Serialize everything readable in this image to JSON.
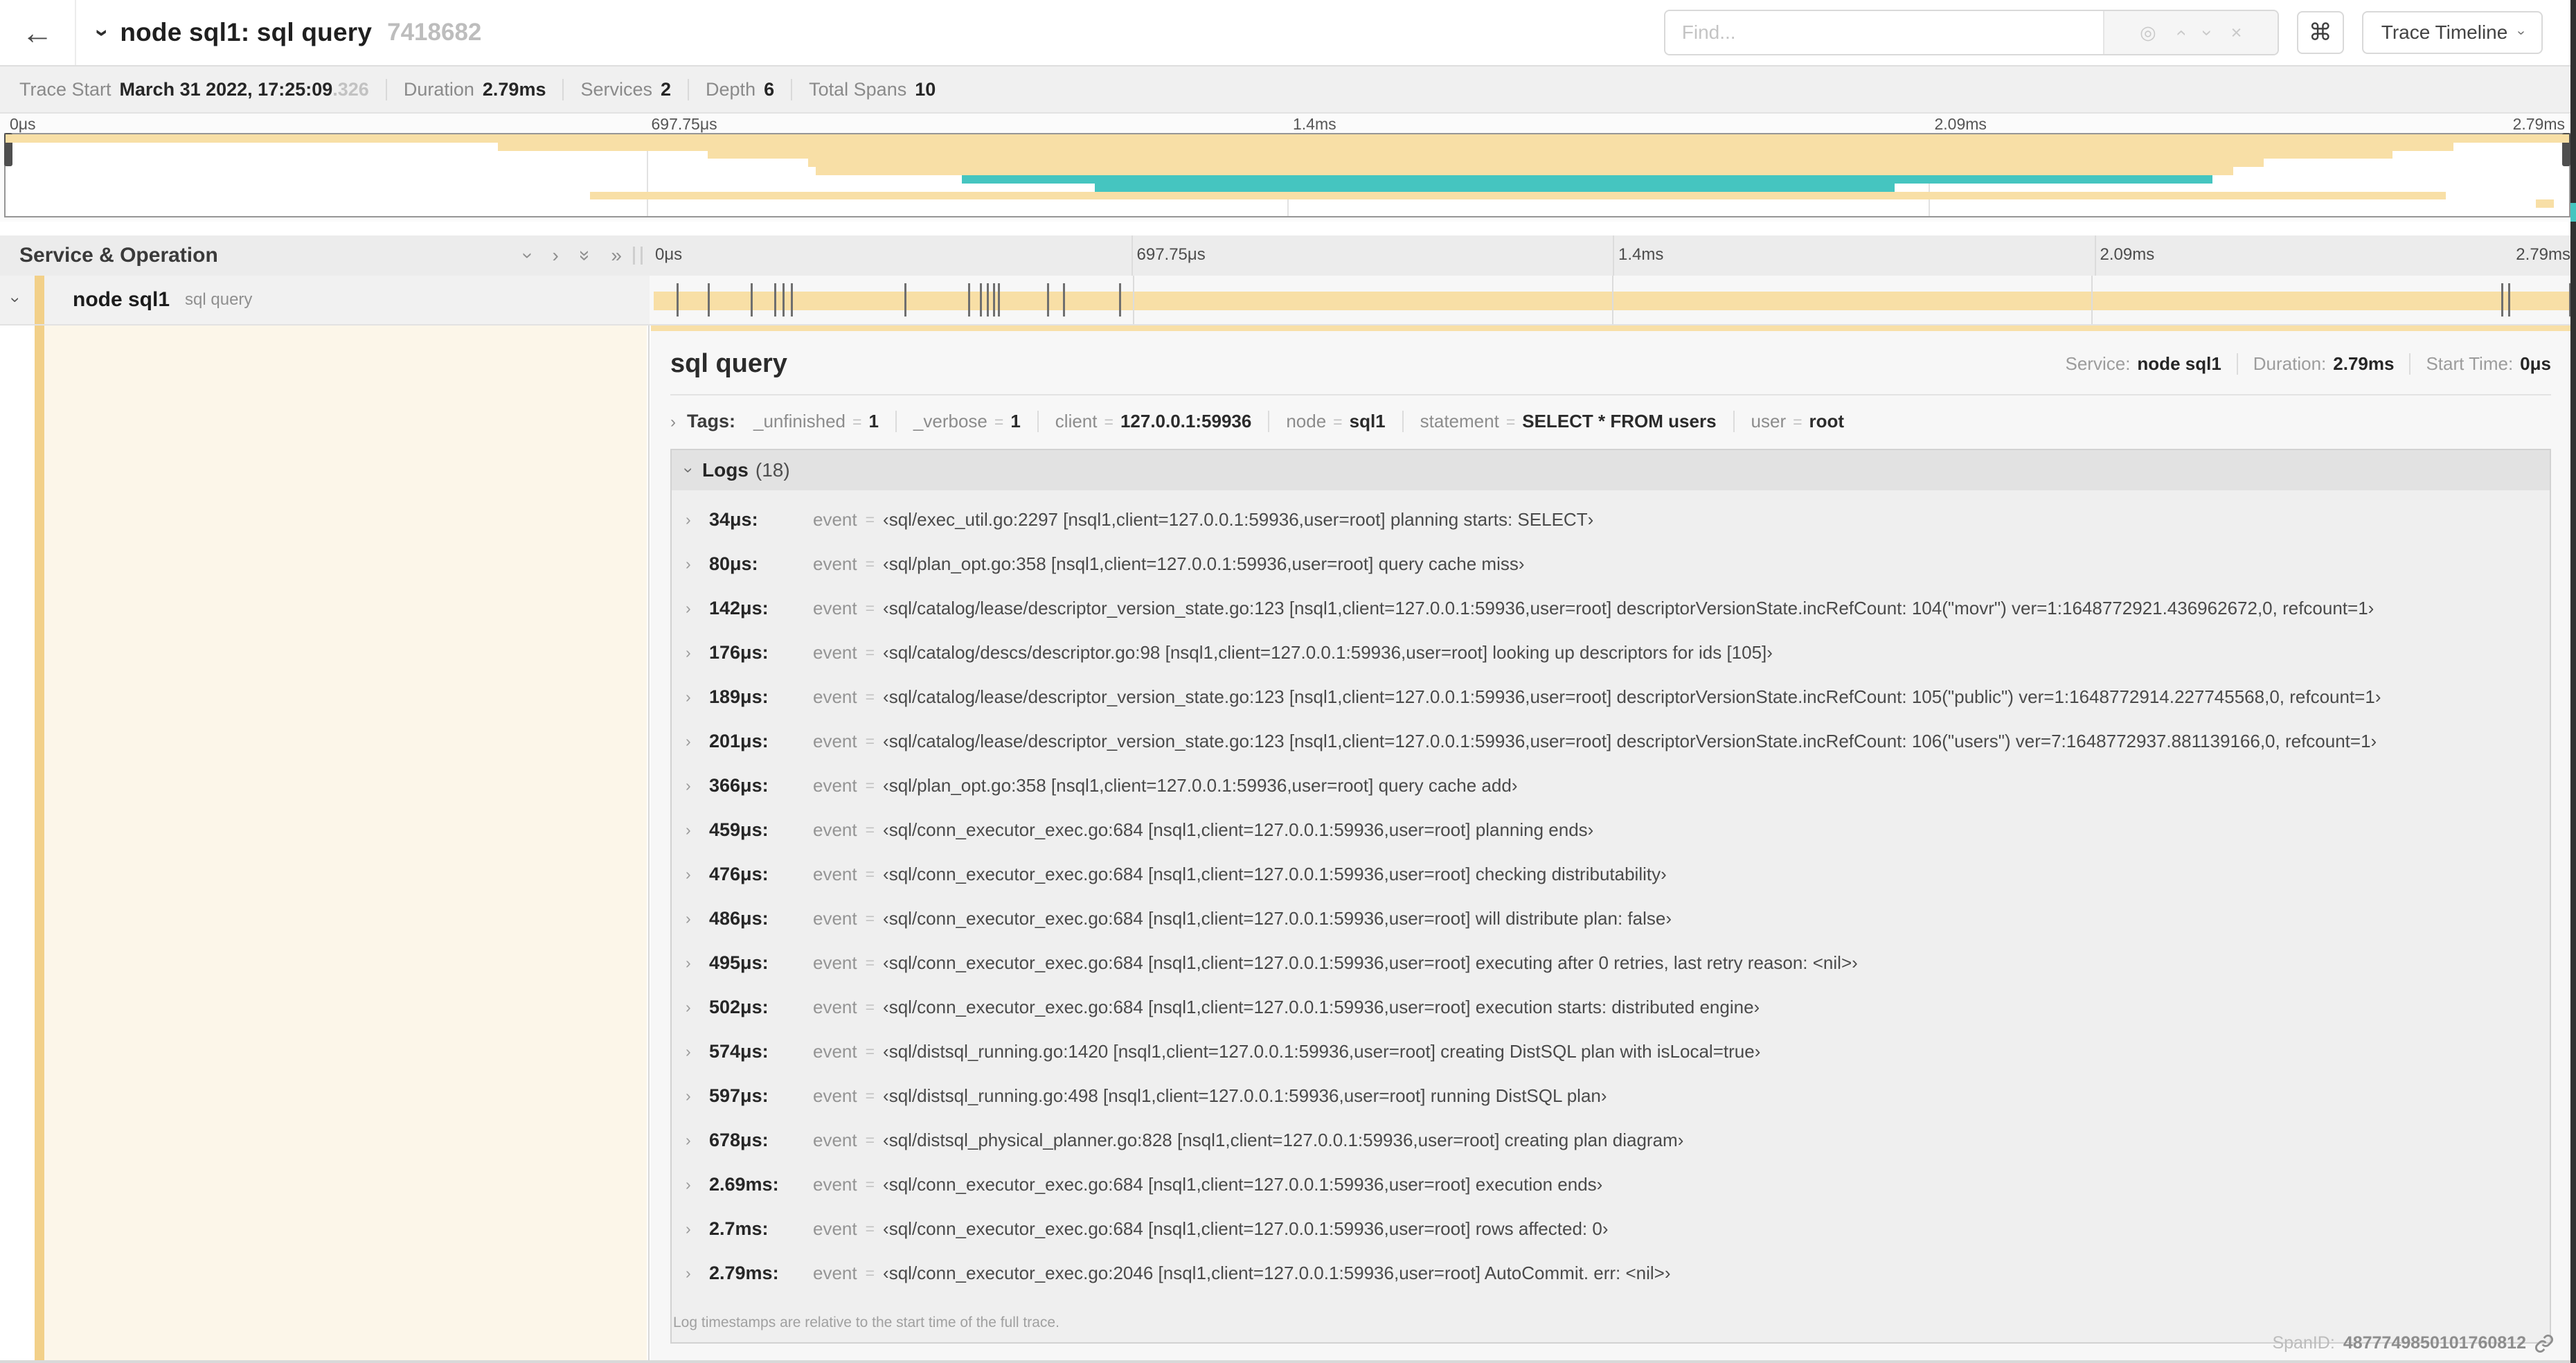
{
  "colors": {
    "bar_orange": "#f8dfa6",
    "accent_orange": "#f2d089",
    "teal": "#45c5c0",
    "cream": "#fcf6e9"
  },
  "topbar": {
    "back_icon": "←",
    "collapse_chevron_icon": "›",
    "title": "node sql1: sql query",
    "trace_id": "7418682",
    "find": {
      "placeholder": "Find...",
      "locate_icon": "◎",
      "prev_icon": "›",
      "next_icon": "›",
      "clear_icon": "×"
    },
    "shortcuts_icon": "⌘",
    "view_menu": {
      "label": "Trace Timeline",
      "chevron_icon": "›"
    }
  },
  "trace_stats": [
    {
      "label": "Trace Start",
      "value": "March 31 2022, 17:25:09",
      "suffix": ".326"
    },
    {
      "label": "Duration",
      "value": "2.79ms",
      "suffix": ""
    },
    {
      "label": "Services",
      "value": "2",
      "suffix": ""
    },
    {
      "label": "Depth",
      "value": "6",
      "suffix": ""
    },
    {
      "label": "Total Spans",
      "value": "10",
      "suffix": ""
    }
  ],
  "minimap": {
    "axis_labels": [
      {
        "text": "0μs",
        "pct": 0
      },
      {
        "text": "697.75μs",
        "pct": 25
      },
      {
        "text": "1.4ms",
        "pct": 50
      },
      {
        "text": "2.09ms",
        "pct": 75
      },
      {
        "text": "2.79ms",
        "pct": 100
      }
    ],
    "gridline_pcts": [
      25,
      50,
      75
    ],
    "spans": [
      {
        "row": 0,
        "start_pct": 0,
        "end_pct": 100,
        "color": "orange"
      },
      {
        "row": 1,
        "start_pct": 19.2,
        "end_pct": 95.5,
        "color": "orange"
      },
      {
        "row": 2,
        "start_pct": 27.4,
        "end_pct": 93.1,
        "color": "orange"
      },
      {
        "row": 3,
        "start_pct": 31.3,
        "end_pct": 88.1,
        "color": "orange"
      },
      {
        "row": 4,
        "start_pct": 31.6,
        "end_pct": 86.9,
        "color": "orange"
      },
      {
        "row": 5,
        "start_pct": 37.3,
        "end_pct": 86.1,
        "color": "teal"
      },
      {
        "row": 6,
        "start_pct": 42.5,
        "end_pct": 73.7,
        "color": "teal"
      },
      {
        "row": 7,
        "start_pct": 22.8,
        "end_pct": 95.2,
        "color": "orange"
      },
      {
        "row": 8,
        "start_pct": 98.7,
        "end_pct": 99.4,
        "color": "orange"
      }
    ]
  },
  "timeline": {
    "column_header": "Service & Operation",
    "toolbar": {
      "collapse_one_icon": "›",
      "expand_one_icon": "›",
      "collapse_all_icon": "»",
      "expand_all_icon": "»"
    },
    "axis_labels": [
      {
        "text": "0μs",
        "pct": 0
      },
      {
        "text": "697.75μs",
        "pct": 25
      },
      {
        "text": "1.4ms",
        "pct": 50
      },
      {
        "text": "2.09ms",
        "pct": 75
      },
      {
        "text": "2.79ms",
        "pct": 100
      }
    ],
    "gridline_pcts": [
      25,
      50,
      75
    ],
    "row": {
      "expander_icon": "›",
      "service": "node sql1",
      "operation": "sql query",
      "bar": {
        "start_pct": 0,
        "end_pct": 100,
        "tick_pcts": [
          1.22,
          2.87,
          5.09,
          6.31,
          6.77,
          7.2,
          13.12,
          16.45,
          17.06,
          17.42,
          17.74,
          18.0,
          20.57,
          21.4,
          24.3,
          96.42,
          96.77,
          99.95
        ]
      }
    }
  },
  "detail": {
    "title": "sql query",
    "meta": [
      {
        "label": "Service:",
        "value": "node sql1"
      },
      {
        "label": "Duration:",
        "value": "2.79ms"
      },
      {
        "label": "Start Time:",
        "value": "0μs"
      }
    ],
    "tags": {
      "expander_icon": "›",
      "label": "Tags:",
      "items": [
        {
          "key": "_unfinished",
          "value": "1"
        },
        {
          "key": "_verbose",
          "value": "1"
        },
        {
          "key": "client",
          "value": "127.0.0.1:59936"
        },
        {
          "key": "node",
          "value": "sql1"
        },
        {
          "key": "statement",
          "value": "SELECT * FROM users"
        },
        {
          "key": "user",
          "value": "root"
        }
      ]
    },
    "logs": {
      "expander_icon": "›",
      "label": "Logs",
      "count": "(18)",
      "entries": [
        {
          "time": "34μs:",
          "key": "event",
          "value": "‹sql/exec_util.go:2297 [nsql1,client=127.0.0.1:59936,user=root] planning starts: SELECT›"
        },
        {
          "time": "80μs:",
          "key": "event",
          "value": "‹sql/plan_opt.go:358 [nsql1,client=127.0.0.1:59936,user=root] query cache miss›"
        },
        {
          "time": "142μs:",
          "key": "event",
          "value": "‹sql/catalog/lease/descriptor_version_state.go:123 [nsql1,client=127.0.0.1:59936,user=root] descriptorVersionState.incRefCount: 104(\"movr\") ver=1:1648772921.436962672,0, refcount=1›"
        },
        {
          "time": "176μs:",
          "key": "event",
          "value": "‹sql/catalog/descs/descriptor.go:98 [nsql1,client=127.0.0.1:59936,user=root] looking up descriptors for ids [105]›"
        },
        {
          "time": "189μs:",
          "key": "event",
          "value": "‹sql/catalog/lease/descriptor_version_state.go:123 [nsql1,client=127.0.0.1:59936,user=root] descriptorVersionState.incRefCount: 105(\"public\") ver=1:1648772914.227745568,0, refcount=1›"
        },
        {
          "time": "201μs:",
          "key": "event",
          "value": "‹sql/catalog/lease/descriptor_version_state.go:123 [nsql1,client=127.0.0.1:59936,user=root] descriptorVersionState.incRefCount: 106(\"users\") ver=7:1648772937.881139166,0, refcount=1›"
        },
        {
          "time": "366μs:",
          "key": "event",
          "value": "‹sql/plan_opt.go:358 [nsql1,client=127.0.0.1:59936,user=root] query cache add›"
        },
        {
          "time": "459μs:",
          "key": "event",
          "value": "‹sql/conn_executor_exec.go:684 [nsql1,client=127.0.0.1:59936,user=root] planning ends›"
        },
        {
          "time": "476μs:",
          "key": "event",
          "value": "‹sql/conn_executor_exec.go:684 [nsql1,client=127.0.0.1:59936,user=root] checking distributability›"
        },
        {
          "time": "486μs:",
          "key": "event",
          "value": "‹sql/conn_executor_exec.go:684 [nsql1,client=127.0.0.1:59936,user=root] will distribute plan: false›"
        },
        {
          "time": "495μs:",
          "key": "event",
          "value": "‹sql/conn_executor_exec.go:684 [nsql1,client=127.0.0.1:59936,user=root] executing after 0 retries, last retry reason: <nil>›"
        },
        {
          "time": "502μs:",
          "key": "event",
          "value": "‹sql/conn_executor_exec.go:684 [nsql1,client=127.0.0.1:59936,user=root] execution starts: distributed engine›"
        },
        {
          "time": "574μs:",
          "key": "event",
          "value": "‹sql/distsql_running.go:1420 [nsql1,client=127.0.0.1:59936,user=root] creating DistSQL plan with isLocal=true›"
        },
        {
          "time": "597μs:",
          "key": "event",
          "value": "‹sql/distsql_running.go:498 [nsql1,client=127.0.0.1:59936,user=root] running DistSQL plan›"
        },
        {
          "time": "678μs:",
          "key": "event",
          "value": "‹sql/distsql_physical_planner.go:828 [nsql1,client=127.0.0.1:59936,user=root] creating plan diagram›"
        },
        {
          "time": "2.69ms:",
          "key": "event",
          "value": "‹sql/conn_executor_exec.go:684 [nsql1,client=127.0.0.1:59936,user=root] execution ends›"
        },
        {
          "time": "2.7ms:",
          "key": "event",
          "value": "‹sql/conn_executor_exec.go:684 [nsql1,client=127.0.0.1:59936,user=root] rows affected: 0›"
        },
        {
          "time": "2.79ms:",
          "key": "event",
          "value": "‹sql/conn_executor_exec.go:2046 [nsql1,client=127.0.0.1:59936,user=root] AutoCommit. err: <nil>›"
        }
      ],
      "footnote": "Log timestamps are relative to the start time of the full trace."
    },
    "span_id": {
      "label": "SpanID:",
      "value": "4877749850101760812"
    }
  }
}
